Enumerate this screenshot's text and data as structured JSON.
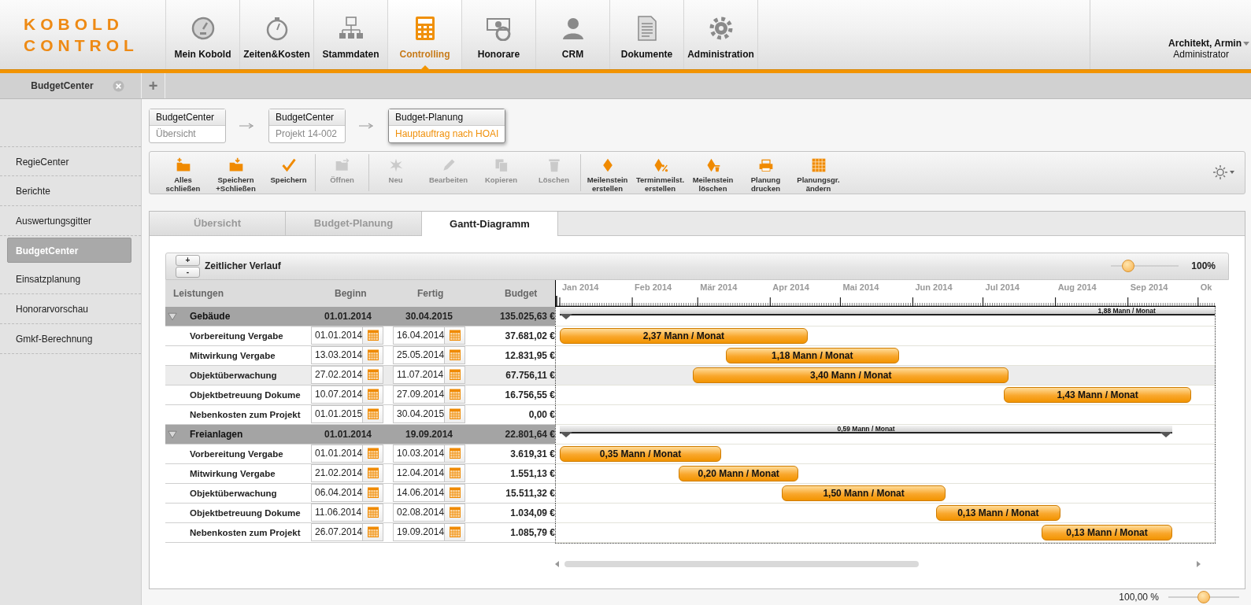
{
  "logo": {
    "line1": "KOBOLD",
    "line2": "CONTROL"
  },
  "nav": [
    {
      "label": "Mein Kobold",
      "selected": false
    },
    {
      "label": "Zeiten&Kosten",
      "selected": false
    },
    {
      "label": "Stammdaten",
      "selected": false
    },
    {
      "label": "Controlling",
      "selected": true
    },
    {
      "label": "Honorare",
      "selected": false
    },
    {
      "label": "CRM",
      "selected": false
    },
    {
      "label": "Dokumente",
      "selected": false
    },
    {
      "label": "Administration",
      "selected": false
    }
  ],
  "user": {
    "name": "Architekt, Armin",
    "role": "Administrator"
  },
  "doc_tabs": [
    {
      "label": "BudgetCenter",
      "selected": true
    }
  ],
  "add_tab": "+",
  "sidebar": {
    "items": [
      {
        "label": "RegieCenter",
        "selected": false
      },
      {
        "label": "Berichte",
        "selected": false
      },
      {
        "label": "Auswertungsgitter",
        "selected": false
      },
      {
        "label": "BudgetCenter",
        "selected": true
      },
      {
        "label": "Einsatzplanung",
        "selected": false
      },
      {
        "label": "Honorarvorschau",
        "selected": false
      },
      {
        "label": "Gmkf-Berechnung",
        "selected": false
      }
    ]
  },
  "breadcrumbs": [
    {
      "title": "BudgetCenter",
      "subtitle": "Übersicht",
      "selected": false
    },
    {
      "title": "BudgetCenter",
      "subtitle": "Projekt 14-002",
      "selected": false
    },
    {
      "title": "Budget-Planung",
      "subtitle": "Hauptauftrag nach HOAI",
      "selected": true
    }
  ],
  "toolbar": {
    "groups": [
      [
        {
          "label": "Alles schließen",
          "disabled": false
        },
        {
          "label": "Speichern +Schließen",
          "disabled": false
        },
        {
          "label": "Speichern",
          "disabled": false
        }
      ],
      [
        {
          "label": "Öffnen",
          "disabled": true
        }
      ],
      [
        {
          "label": "Neu",
          "disabled": true
        },
        {
          "label": "Bearbeiten",
          "disabled": true
        },
        {
          "label": "Kopieren",
          "disabled": true
        },
        {
          "label": "Löschen",
          "disabled": true
        }
      ],
      [
        {
          "label": "Meilenstein erstellen",
          "disabled": false
        },
        {
          "label": "Terminmeilst. erstellen",
          "disabled": false
        },
        {
          "label": "Meilenstein löschen",
          "disabled": false
        },
        {
          "label": "Planung drucken",
          "disabled": false
        },
        {
          "label": "Planungsgr. ändern",
          "disabled": false
        }
      ]
    ]
  },
  "tabs": [
    {
      "label": "Übersicht",
      "selected": false
    },
    {
      "label": "Budget-Planung",
      "selected": false
    },
    {
      "label": "Gantt-Diagramm",
      "selected": true
    }
  ],
  "gantt": {
    "title": "Zeitlicher Verlauf",
    "zoom_in": "+",
    "zoom_out": "-",
    "zoom": {
      "level": 0.25,
      "reading": "100%"
    },
    "columns": [
      "Leistungen",
      "Beginn",
      "Fertig",
      "Budget"
    ],
    "months": [
      "Jan 2014",
      "Feb 2014",
      "Mär 2014",
      "Apr 2014",
      "Mai 2014",
      "Jun 2014",
      "Jul 2014",
      "Aug 2014",
      "Sep 2014",
      "Ok"
    ],
    "groups": [
      {
        "name": "Gebäude",
        "expanded": true,
        "begin": "01.01.2014",
        "end": "30.04.2015",
        "budget": "135.025,63 €",
        "bar_label": "1,88 Mann / Monat",
        "tasks": [
          {
            "name": "Vorbereitung Vergabe",
            "begin": "01.01.2014",
            "end": "16.04.2014",
            "budget": "37.681,02 €",
            "bar_label": "2,37 Mann / Monat",
            "selected": false
          },
          {
            "name": "Mitwirkung Vergabe",
            "begin": "13.03.2014",
            "end": "25.05.2014",
            "budget": "12.831,95 €",
            "bar_label": "1,18 Mann / Monat",
            "selected": false
          },
          {
            "name": "Objektüberwachung",
            "begin": "27.02.2014",
            "end": "11.07.2014",
            "budget": "67.756,11 €",
            "bar_label": "3,40 Mann / Monat",
            "selected": true
          },
          {
            "name": "Objektbetreuung Dokume",
            "begin": "10.07.2014",
            "end": "27.09.2014",
            "budget": "16.756,55 €",
            "bar_label": "1,43 Mann / Monat",
            "selected": false
          },
          {
            "name": "Nebenkosten zum Projekt",
            "begin": "01.01.2015",
            "end": "30.04.2015",
            "budget": "0,00 €",
            "selected": false
          }
        ]
      },
      {
        "name": "Freianlagen",
        "expanded": true,
        "begin": "01.01.2014",
        "end": "19.09.2014",
        "budget": "22.801,64 €",
        "bar_label": "0,59 Mann / Monat",
        "tasks": [
          {
            "name": "Vorbereitung Vergabe",
            "begin": "01.01.2014",
            "end": "10.03.2014",
            "budget": "3.619,31 €",
            "bar_label": "0,35 Mann / Monat",
            "selected": false
          },
          {
            "name": "Mitwirkung Vergabe",
            "begin": "21.02.2014",
            "end": "12.04.2014",
            "budget": "1.551,13 €",
            "bar_label": "0,20 Mann / Monat",
            "selected": false
          },
          {
            "name": "Objektüberwachung",
            "begin": "06.04.2014",
            "end": "14.06.2014",
            "budget": "15.511,32 €",
            "bar_label": "1,50 Mann / Monat",
            "selected": false
          },
          {
            "name": "Objektbetreuung Dokume",
            "begin": "11.06.2014",
            "end": "02.08.2014",
            "budget": "1.034,09 €",
            "bar_label": "0,13 Mann / Monat",
            "selected": false
          },
          {
            "name": "Nebenkosten zum Projekt",
            "begin": "26.07.2014",
            "end": "19.09.2014",
            "budget": "1.085,79 €",
            "bar_label": "0,13 Mann / Monat",
            "selected": false
          }
        ]
      }
    ]
  },
  "footer": {
    "reading": "100,00 %",
    "level": 0.5
  }
}
